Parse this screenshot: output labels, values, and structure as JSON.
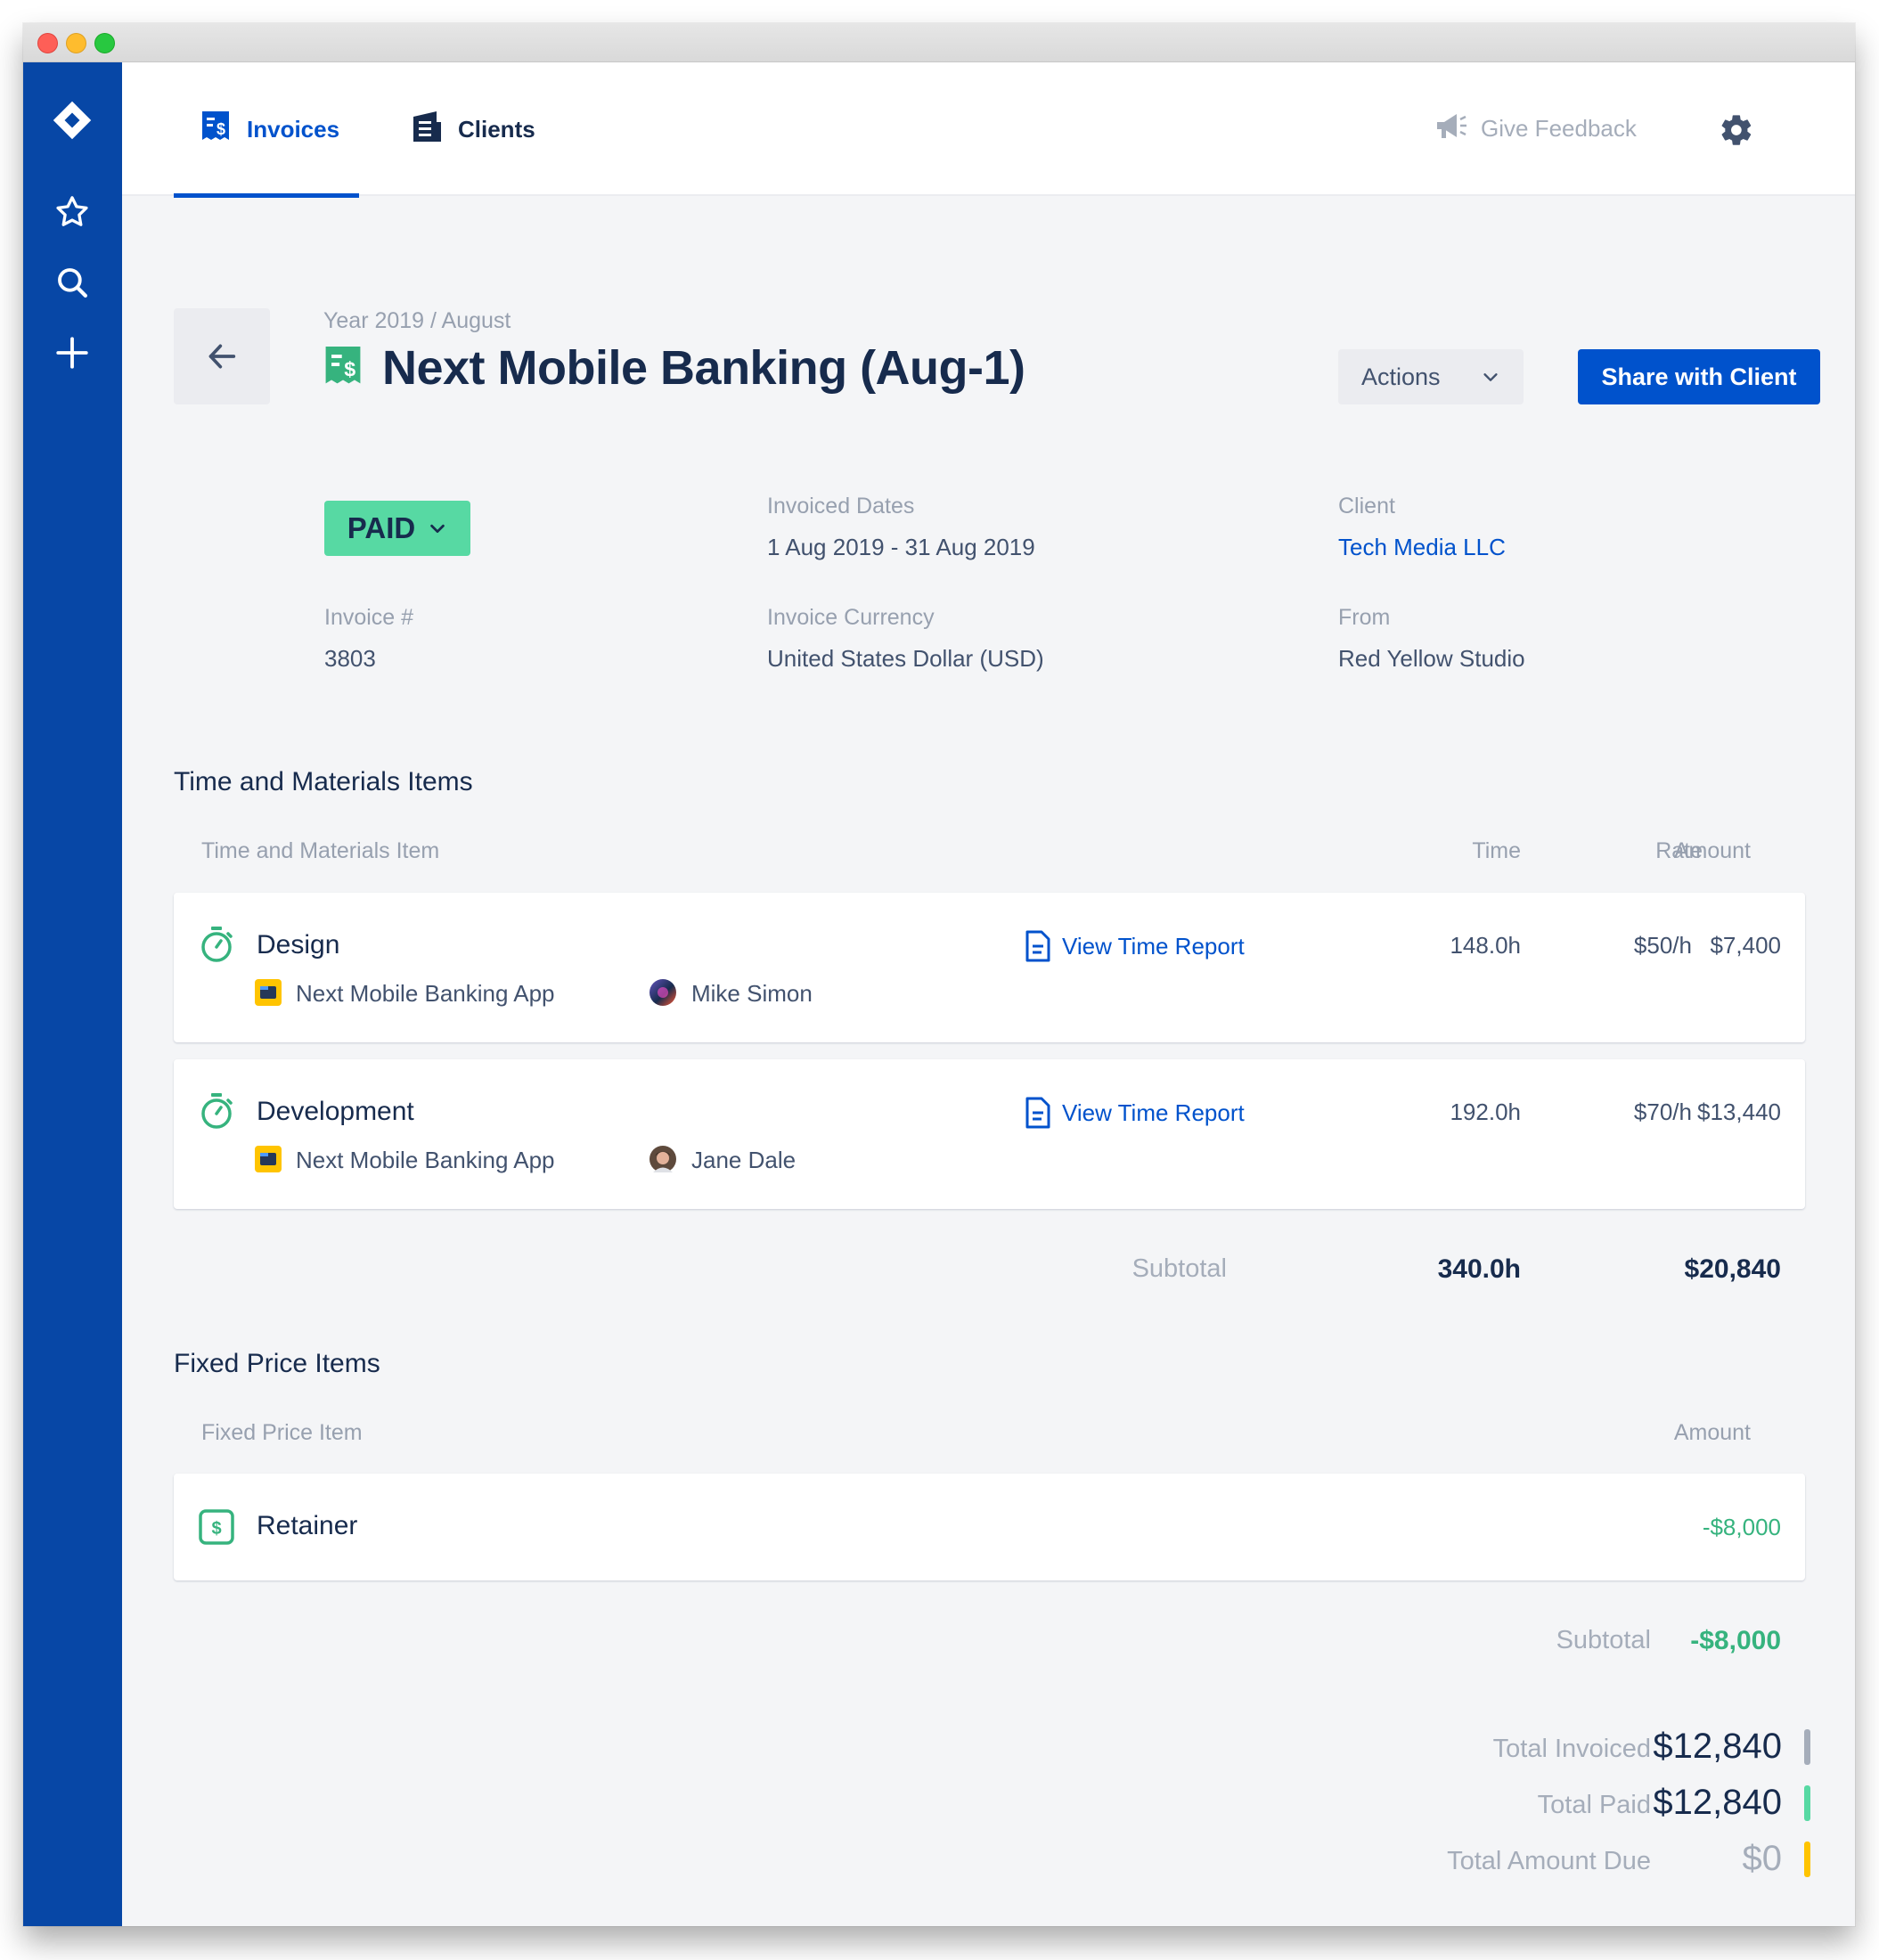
{
  "nav": {
    "invoices_label": "Invoices",
    "clients_label": "Clients",
    "feedback_label": "Give Feedback"
  },
  "header": {
    "breadcrumb": "Year 2019 / August",
    "title": "Next Mobile Banking (Aug-1)",
    "actions_label": "Actions",
    "share_label": "Share with Client"
  },
  "details": {
    "status": "PAID",
    "invoiced_dates_label": "Invoiced Dates",
    "invoiced_dates_value": "1 Aug 2019 - 31 Aug 2019",
    "client_label": "Client",
    "client_value": "Tech Media LLC",
    "invoice_number_label": "Invoice #",
    "invoice_number_value": "3803",
    "currency_label": "Invoice Currency",
    "currency_value": "United States Dollar (USD)",
    "from_label": "From",
    "from_value": "Red Yellow Studio"
  },
  "time_materials": {
    "section_title": "Time and Materials Items",
    "headers": {
      "item": "Time and Materials Item",
      "time": "Time",
      "rate": "Rate",
      "amount": "Amount"
    },
    "items": [
      {
        "name": "Design",
        "project": "Next Mobile Banking App",
        "person": "Mike Simon",
        "report_label": "View Time Report",
        "time": "148.0h",
        "rate": "$50/h",
        "amount": "$7,400"
      },
      {
        "name": "Development",
        "project": "Next Mobile Banking App",
        "person": "Jane Dale",
        "report_label": "View Time Report",
        "time": "192.0h",
        "rate": "$70/h",
        "amount": "$13,440"
      }
    ],
    "subtotal_label": "Subtotal",
    "subtotal_time": "340.0h",
    "subtotal_amount": "$20,840"
  },
  "fixed_price": {
    "section_title": "Fixed Price Items",
    "headers": {
      "item": "Fixed Price Item",
      "amount": "Amount"
    },
    "items": [
      {
        "name": "Retainer",
        "amount": "-$8,000"
      }
    ],
    "subtotal_label": "Subtotal",
    "subtotal_amount": "-$8,000"
  },
  "totals": {
    "invoiced_label": "Total Invoiced",
    "invoiced_value": "$12,840",
    "paid_label": "Total Paid",
    "paid_value": "$12,840",
    "due_label": "Total Amount Due",
    "due_value": "$0"
  },
  "colors": {
    "sidebar": "#0747a6",
    "primary": "#0052cc",
    "paid_badge": "#57d9a3",
    "success": "#36b37e",
    "invoiced_bar": "#a5adba",
    "paid_bar": "#57d9a3",
    "due_bar": "#ffc400"
  },
  "icons": {
    "sidebar": [
      "jira-logo-icon",
      "star-icon",
      "search-icon",
      "plus-icon"
    ],
    "nav": [
      "invoice-icon",
      "clients-building-icon",
      "megaphone-icon",
      "gear-icon"
    ],
    "items": [
      "stopwatch-icon",
      "project-folder-icon",
      "document-icon",
      "dollar-icon"
    ]
  }
}
